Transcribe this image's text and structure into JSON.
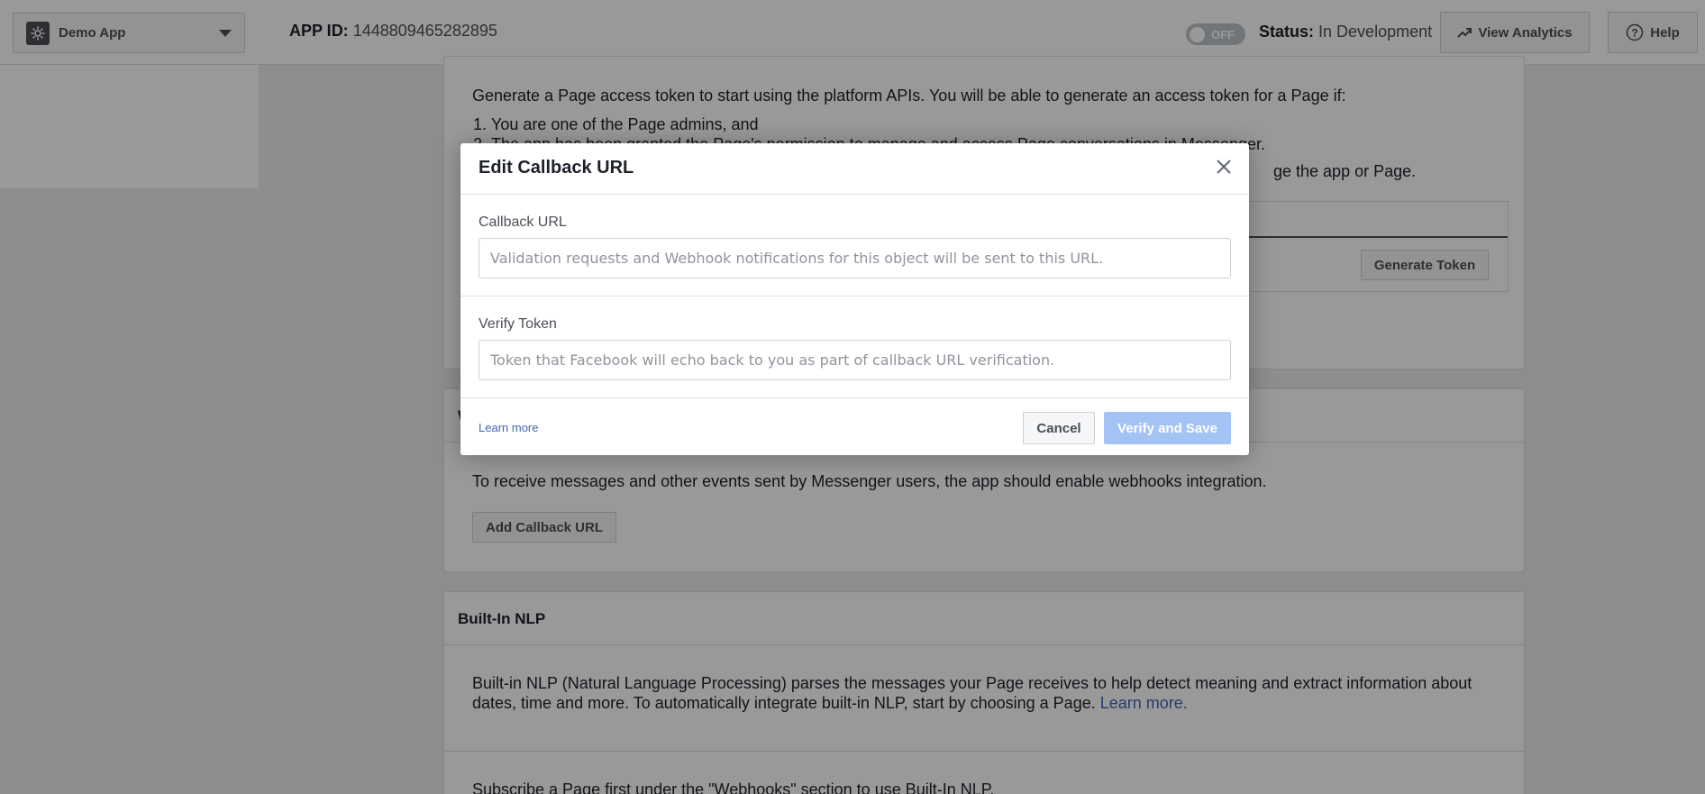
{
  "topbar": {
    "app_name": "Demo App",
    "app_id_label": "APP ID:",
    "app_id_value": "1448809465282895",
    "toggle_text": "OFF",
    "status_label": "Status:",
    "status_value": "In Development",
    "analytics_label": "View Analytics",
    "help_label": "Help"
  },
  "panel1": {
    "intro": "Generate a Page access token to start using the platform APIs. You will be able to generate an access token for a Page if:",
    "list": [
      "You are one of the Page admins, and",
      "The app has been granted the Page's permission to manage and access Page conversations in Messenger."
    ],
    "after_text": "ge the app or Page.",
    "generate_token": "Generate Token"
  },
  "panel2": {
    "title_letter": "W",
    "text": "To receive messages and other events sent by Messenger users, the app should enable webhooks integration.",
    "add_callback": "Add Callback URL"
  },
  "panel3": {
    "title": "Built-In NLP",
    "text": "Built-in NLP (Natural Language Processing) parses the messages your Page receives to help detect meaning and extract information about dates, time and more. To automatically integrate built-in NLP, start by choosing a Page.",
    "learn_more": "Learn more.",
    "subtext": "Subscribe a Page first under the \"Webhooks\" section to use Built-In NLP."
  },
  "dialog": {
    "title": "Edit Callback URL",
    "callback_label": "Callback URL",
    "callback_placeholder": "Validation requests and Webhook notifications for this object will be sent to this URL.",
    "verify_label": "Verify Token",
    "verify_placeholder": "Token that Facebook will echo back to you as part of callback URL verification.",
    "learn_more": "Learn more",
    "cancel": "Cancel",
    "verify_save": "Verify and Save"
  },
  "colors": {
    "overlay": "rgba(0,0,0,0.4)",
    "link": "#4267b2",
    "verify_disabled": "#a4c3f4"
  },
  "icons": [
    "gear-icon",
    "caret-down-icon",
    "trending-up-icon",
    "help-circle-icon",
    "close-icon"
  ]
}
